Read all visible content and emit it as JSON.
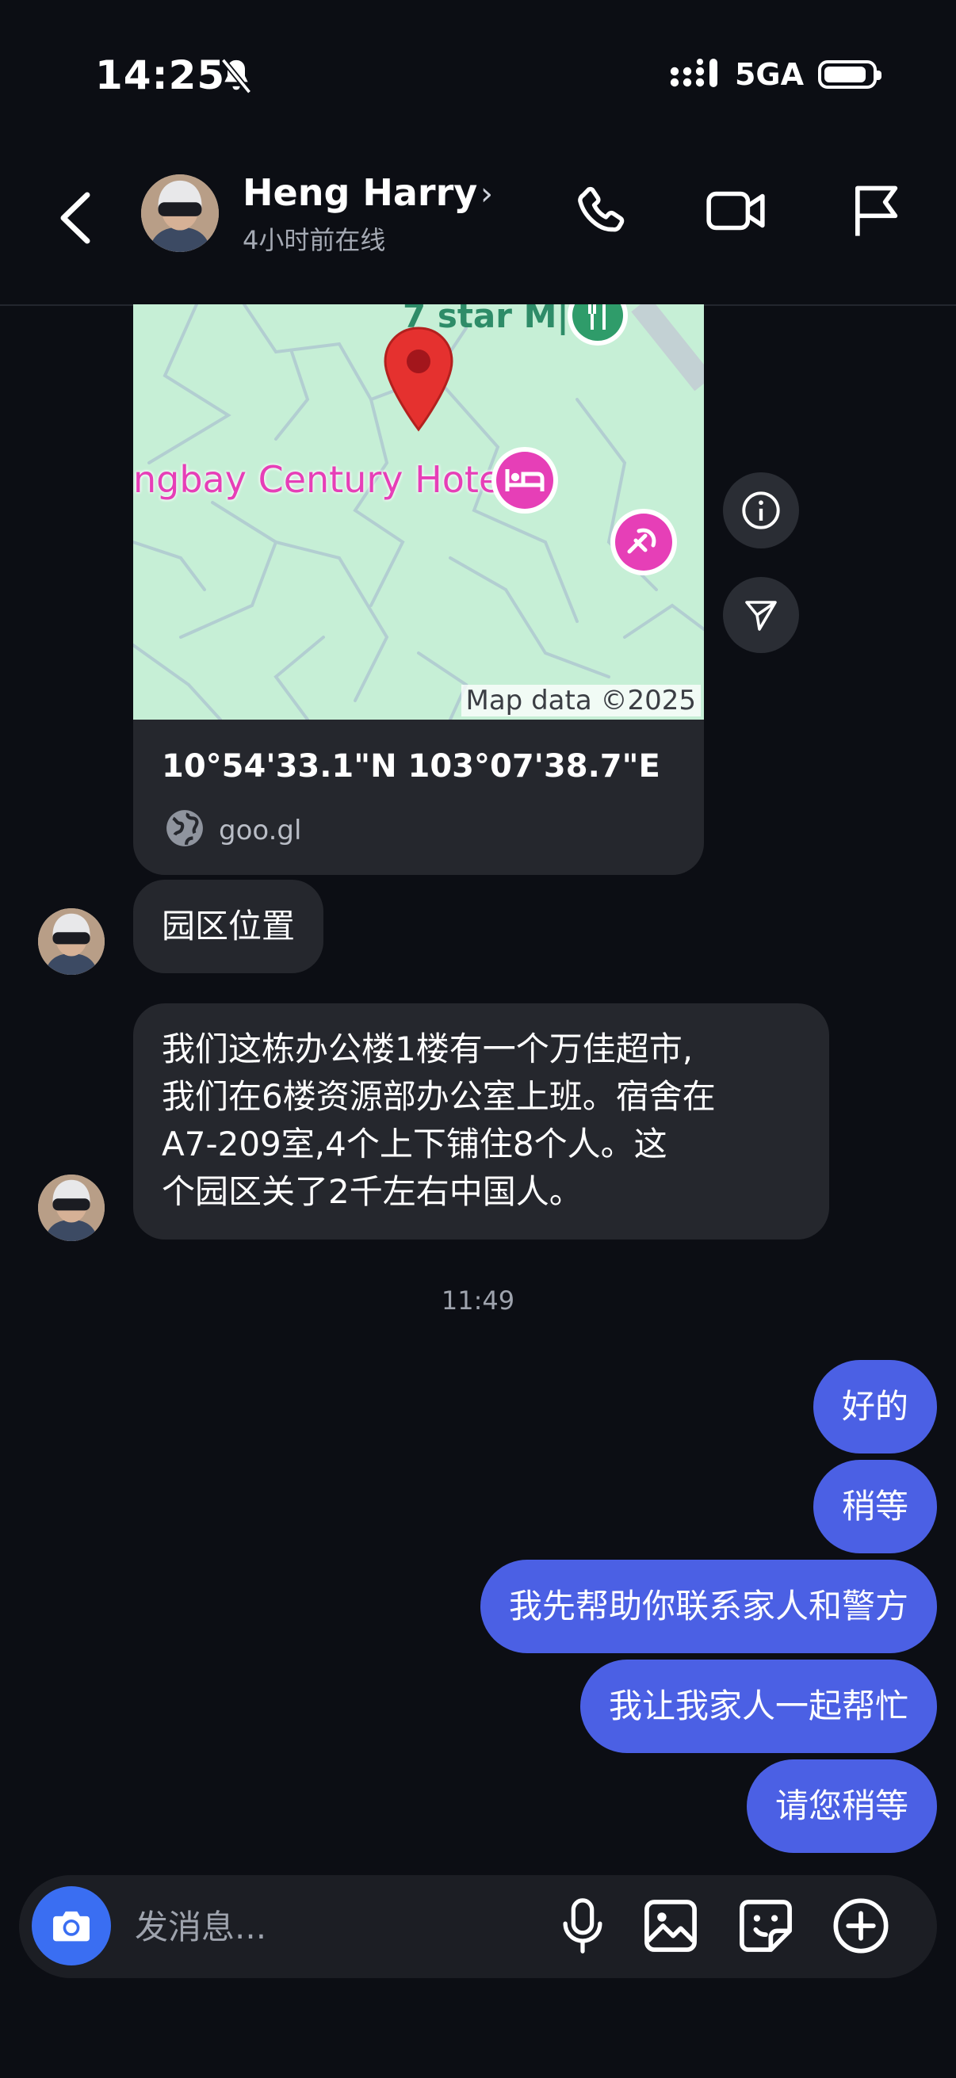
{
  "status_bar": {
    "time": "14:25",
    "network": "5GA",
    "battery_level": 0.9
  },
  "header": {
    "name": "Heng Harry",
    "status": "4小时前在线"
  },
  "map_card": {
    "map_labels": {
      "restaurant": "7 star M|",
      "hotel": "ngbay Century Hotel",
      "attribution": "Map data ©2025"
    },
    "coordinates": "10°54'33.1\"N 103°07'38.7\"E",
    "link": "goo.gl"
  },
  "messages_in": [
    {
      "text": "园区位置"
    },
    {
      "lines": [
        "我们这栋办公楼1楼有一个万佳超市,",
        "我们在6楼资源部办公室上班。宿舍在",
        "A7-209室,4个上下铺住8个人。这",
        "个园区关了2千左右中国人。"
      ]
    }
  ],
  "timestamp": "11:49",
  "messages_out": [
    {
      "text": "好的"
    },
    {
      "text": "稍等"
    },
    {
      "text": "我先帮助你联系家人和警方"
    },
    {
      "text": "我让我家人一起帮忙"
    },
    {
      "text": "请您稍等"
    }
  ],
  "composer": {
    "placeholder": "发消息..."
  },
  "colors": {
    "background": "#0c0e14",
    "bubble_in": "#25272d",
    "bubble_out": "#4b60e4",
    "camera_button": "#3a6ef2",
    "map": "#c6efd6",
    "pin": "#e5312f",
    "poi": "#e63fb7"
  },
  "icons": [
    "bell-slash-icon",
    "signal-icon",
    "battery-icon",
    "back-chevron-icon",
    "phone-icon",
    "video-icon",
    "flag-icon",
    "info-icon",
    "send-icon",
    "globe-icon",
    "camera-icon",
    "mic-icon",
    "image-icon",
    "sticker-icon",
    "plus-circle-icon",
    "map-pin-icon",
    "hotel-icon",
    "restaurant-icon"
  ]
}
